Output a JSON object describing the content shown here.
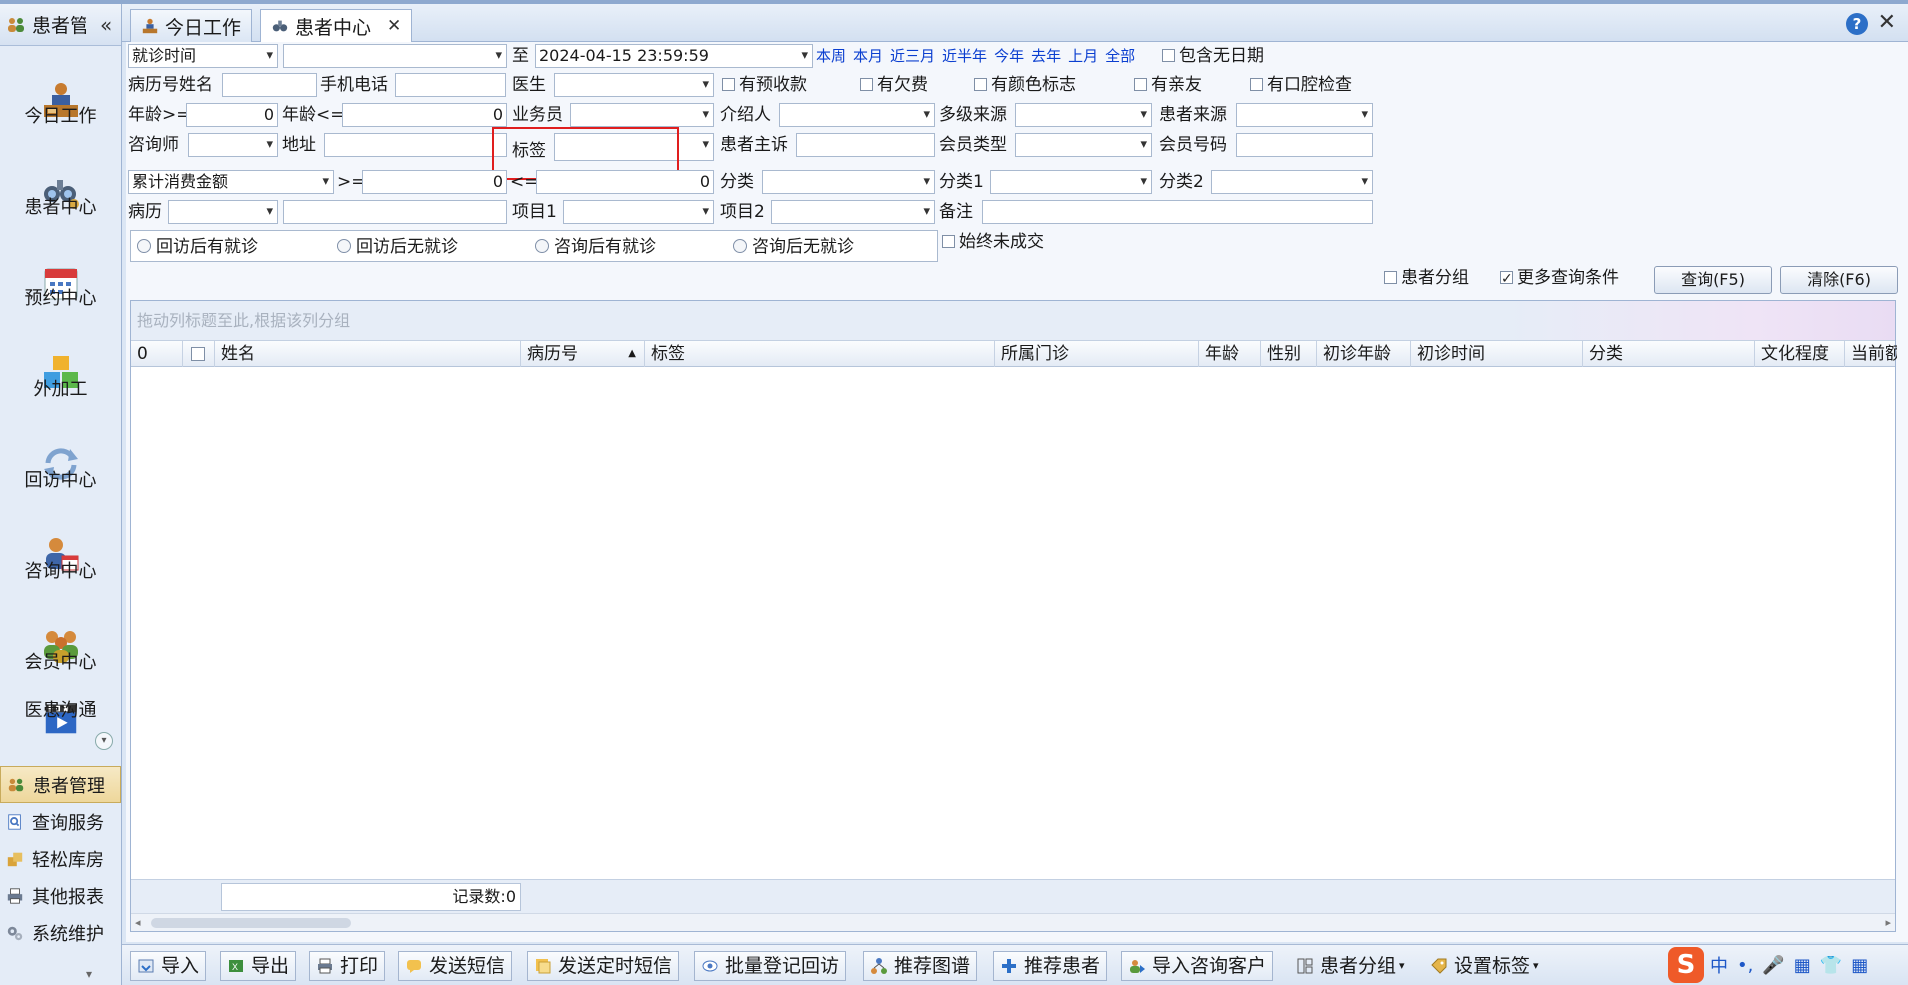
{
  "nav": {
    "header_title": "患者管理",
    "collapse": "«",
    "big_items": [
      {
        "label": "今日工作"
      },
      {
        "label": "患者中心"
      },
      {
        "label": "预约中心"
      },
      {
        "label": "外加工"
      },
      {
        "label": "回访中心"
      },
      {
        "label": "咨询中心"
      },
      {
        "label": "会员中心"
      },
      {
        "label": "医患沟通"
      }
    ],
    "small_items": [
      {
        "label": "患者管理"
      },
      {
        "label": "查询服务"
      },
      {
        "label": "轻松库房"
      },
      {
        "label": "其他报表"
      },
      {
        "label": "系统维护"
      }
    ]
  },
  "tabs": [
    {
      "label": "今日工作"
    },
    {
      "label": "患者中心"
    }
  ],
  "filters": {
    "date_type": "就诊时间",
    "date_from": "",
    "to_label": "至",
    "date_to": "2024-04-15 23:59:59",
    "quick_ranges": [
      "本周",
      "本月",
      "近三月",
      "近半年",
      "今年",
      "去年",
      "上月",
      "全部"
    ],
    "include_no_date": "包含无日期",
    "row2": {
      "record_name_label": "病历号姓名",
      "phone_label": "手机电话",
      "doctor_label": "医生",
      "checks": [
        "有预收款",
        "有欠费",
        "有颜色标志",
        "有亲友",
        "有口腔检查"
      ]
    },
    "row3": {
      "age_ge_label": "年龄>=",
      "age_ge_value": "0",
      "age_le_label": "年龄<=",
      "age_le_value": "0",
      "salesman_label": "业务员",
      "referrer_label": "介绍人",
      "multi_source_label": "多级来源",
      "patient_source_label": "患者来源"
    },
    "row4": {
      "consultant_label": "咨询师",
      "address_label": "地址",
      "tag_label": "标签",
      "complaint_label": "患者主诉",
      "member_type_label": "会员类型",
      "member_no_label": "会员号码"
    },
    "row5": {
      "amount_type": "累计消费金额",
      "ge_label": ">=",
      "ge_value": "0",
      "le_label": "<=",
      "le_value": "0",
      "category_label": "分类",
      "category1_label": "分类1",
      "category2_label": "分类2"
    },
    "row6": {
      "record_label": "病历",
      "item1_label": "项目1",
      "item2_label": "项目2",
      "remark_label": "备注"
    },
    "radios": [
      "回访后有就诊",
      "回访后无就诊",
      "咨询后有就诊",
      "咨询后无就诊"
    ],
    "never_deal": "始终未成交",
    "patient_group": "患者分组",
    "more_conditions": "更多查询条件",
    "query_button": "查询(F5)",
    "clear_button": "清除(F6)"
  },
  "grid": {
    "group_hint": "拖动列标题至此,根据该列分组",
    "columns": [
      "0",
      "",
      "姓名",
      "病历号",
      "标签",
      "所属门诊",
      "年龄",
      "性别",
      "初诊年龄",
      "初诊时间",
      "分类",
      "文化程度",
      "当前额"
    ],
    "record_count": "记录数:0"
  },
  "toolbar": [
    {
      "label": "导入"
    },
    {
      "label": "导出"
    },
    {
      "label": "打印"
    },
    {
      "label": "发送短信"
    },
    {
      "label": "发送定时短信"
    },
    {
      "label": "批量登记回访"
    },
    {
      "label": "推荐图谱"
    },
    {
      "label": "推荐患者"
    },
    {
      "label": "导入咨询客户"
    },
    {
      "label": "患者分组"
    },
    {
      "label": "设置标签"
    }
  ],
  "ime": [
    "中",
    "•,",
    "🎤",
    "▦",
    "👕",
    "▦"
  ]
}
